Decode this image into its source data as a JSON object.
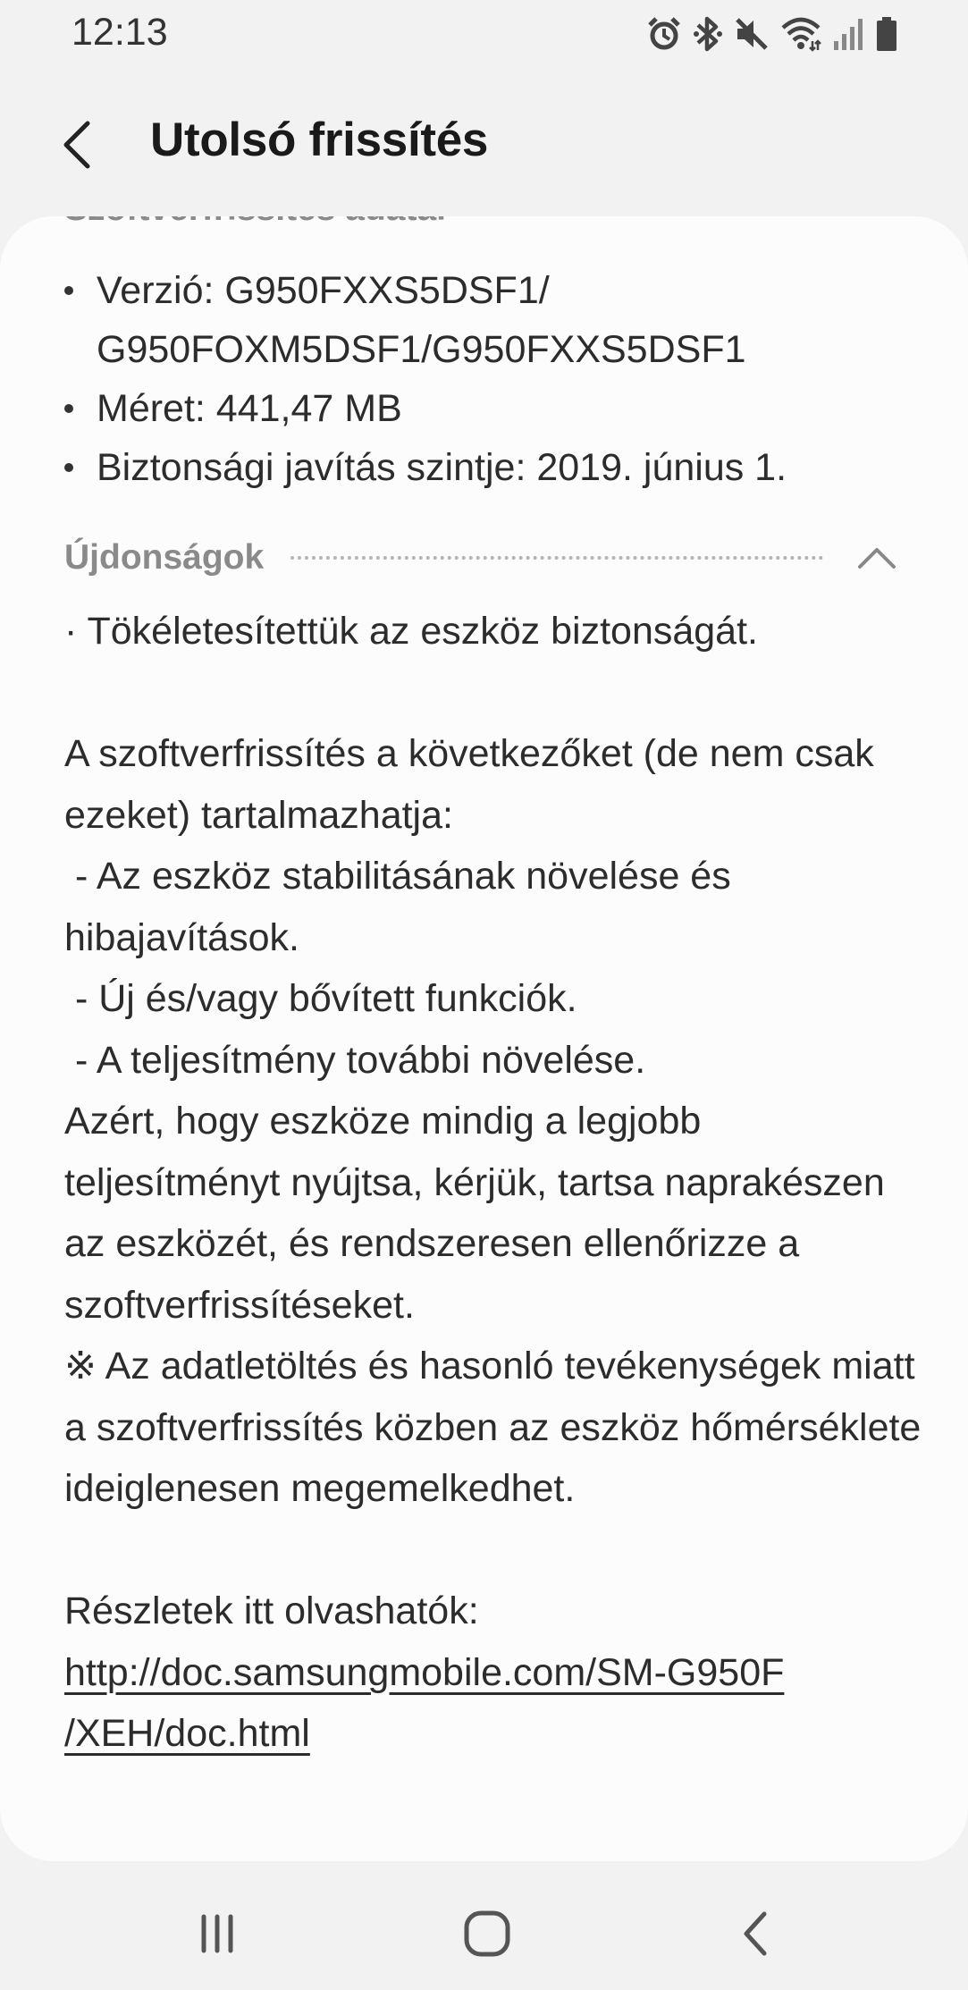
{
  "status_bar": {
    "time": "12:13",
    "icons": [
      "alarm-icon",
      "bluetooth-icon",
      "mute-icon",
      "wifi-icon",
      "signal-icon",
      "battery-icon"
    ]
  },
  "header": {
    "title": "Utolsó frissítés",
    "back_icon": "back-arrow-icon"
  },
  "software_update_info": {
    "heading": "Szoftverfrissítés adatai",
    "version_line1": "Verzió: G950FXXS5DSF1/",
    "version_line2": "G950FOXM5DSF1/G950FXXS5DSF1",
    "size": "Méret: 441,47 MB",
    "security_patch": "Biztonsági javítás szintje: 2019. június 1."
  },
  "whats_new": {
    "heading": "Újdonságok",
    "collapse_icon": "chevron-up-icon",
    "body": "· Tökéletesítettük az eszköz biztonságát.\n\nA szoftverfrissítés a következőket (de nem csak ezeket) tartalmazhatja:\n - Az eszköz stabilitásának növelése és hibajavítások.\n - Új és/vagy bővített funkciók.\n - A teljesítmény további növelése.\nAzért, hogy eszköze mindig a legjobb teljesítményt nyújtsa, kérjük, tartsa naprakészen az eszközét, és rendszeresen ellenőrizze a szoftverfrissítéseket.\n※ Az adatletöltés és hasonló tevékenységek miatt a szoftverfrissítés közben az eszköz hőmérséklete ideiglenesen megemelkedhet.\n\nRészletek itt olvashatók:",
    "link_line1": "http://doc.samsungmobile.com/SM-G950F",
    "link_line2": "/XEH/doc.html"
  },
  "nav_bar": {
    "icons": [
      "recent-apps-icon",
      "home-icon",
      "back-icon"
    ]
  }
}
